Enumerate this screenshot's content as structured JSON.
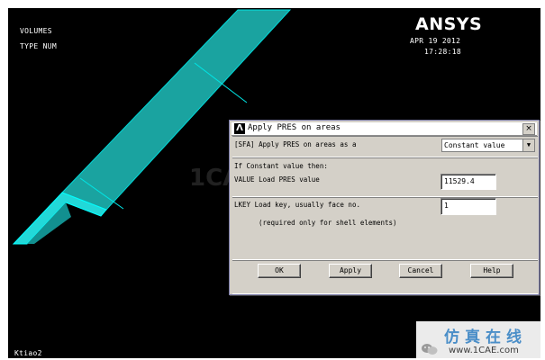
{
  "viewport": {
    "label_volumes": "VOLUMES",
    "label_type": "TYPE NUM",
    "logo_text": "ANSYS",
    "date": "APR 19 2012",
    "time": "17:28:18",
    "bottom_label": "Ktiao2",
    "model_color": "#1aa3a0",
    "model_edge_color": "#00e6e6"
  },
  "dialog": {
    "title": "Apply PRES on areas",
    "close_label": "×",
    "row1_label": "[SFA] Apply PRES on areas as a",
    "row1_select": "Constant value",
    "row2_heading": "If Constant value then:",
    "row2_label": "VALUE  Load PRES value",
    "row2_value": "11529.4",
    "row3_label": "LKEY  Load key, usually face no.",
    "row3_value": "1",
    "row3_note": "(required only for shell elements)",
    "buttons": {
      "ok": "OK",
      "apply": "Apply",
      "cancel": "Cancel",
      "help": "Help"
    }
  },
  "watermark": {
    "center": "1CAE.COM",
    "top": "仿真在线",
    "bottom": "www.1CAE.com"
  }
}
